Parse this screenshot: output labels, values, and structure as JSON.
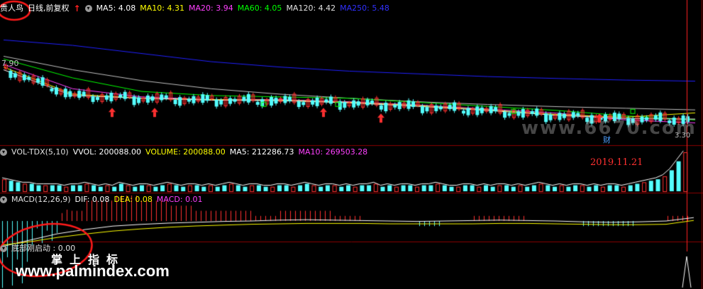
{
  "header": {
    "stock_name": "贵人鸟",
    "period": "日线,前复权",
    "ma5": "MA5: 4.08",
    "ma10": "MA10: 4.31",
    "ma20": "MA20: 3.94",
    "ma60": "MA60: 4.05",
    "ma120": "MA120: 4.42",
    "ma250": "MA250: 5.48"
  },
  "price_high_label": "7.90",
  "price_low_label": "3.30",
  "date_annotation": "2019.11.21",
  "cai_label": "财",
  "volume_header": {
    "name": "VOL-TDX(5,10)",
    "vvol": "VVOL: 200088.00",
    "volume": "VOLUME: 200088.00",
    "ma5": "MA5: 212286.73",
    "ma10": "MA10: 269503.28"
  },
  "macd_header": {
    "name": "MACD(12,26,9)",
    "dif": "DIF: 0.08",
    "dea": "DEA: 0.08",
    "macd": "MACD: 0.01"
  },
  "indicator_header": {
    "name": "底部刚启动 : 0.00"
  },
  "watermarks": {
    "site": "www.palmindex.com",
    "brand": "掌上指标",
    "overlay": "www.6670.com"
  },
  "colors": {
    "ma5": "#ffffff",
    "ma10": "#ffff00",
    "ma20": "#ff40ff",
    "ma60": "#00ff00",
    "ma120": "#c0c0c0",
    "ma250": "#2020ff",
    "up": "#ff3030",
    "down": "#54ffff",
    "grid": "#8b0000"
  },
  "chart_data": {
    "type": "line",
    "ylim": [
      3.3,
      7.9
    ],
    "series": [
      {
        "name": "MA250",
        "values": [
          7.0,
          6.8,
          6.5,
          6.2,
          6.0,
          5.85,
          5.75,
          5.65,
          5.58,
          5.52,
          5.48
        ]
      },
      {
        "name": "MA120",
        "values": [
          6.4,
          5.9,
          5.5,
          5.2,
          5.0,
          4.85,
          4.72,
          4.62,
          4.54,
          4.48,
          4.42
        ]
      },
      {
        "name": "MA60",
        "values": [
          6.3,
          5.6,
          5.1,
          4.95,
          4.9,
          4.85,
          4.7,
          4.55,
          4.4,
          4.2,
          4.05
        ]
      },
      {
        "name": "MA20",
        "values": [
          6.1,
          5.2,
          4.9,
          4.8,
          4.8,
          4.72,
          4.6,
          4.45,
          4.3,
          4.05,
          3.94
        ]
      },
      {
        "name": "MA10",
        "values": [
          6.0,
          5.0,
          4.85,
          4.8,
          4.78,
          4.7,
          4.58,
          4.42,
          4.25,
          4.15,
          4.31
        ]
      },
      {
        "name": "MA5",
        "values": [
          5.9,
          4.95,
          4.85,
          4.78,
          4.76,
          4.68,
          4.55,
          4.4,
          4.22,
          4.1,
          4.08
        ]
      }
    ],
    "volume": [
      8,
      7,
      6,
      5,
      5,
      4,
      4,
      4,
      4,
      3,
      4,
      4,
      5,
      4,
      3,
      4,
      3,
      5,
      4,
      3,
      4,
      4,
      3,
      4,
      5,
      4,
      3,
      4,
      4,
      3,
      4,
      3,
      4,
      5,
      4,
      3,
      4,
      4,
      3,
      3,
      4,
      4,
      3,
      4,
      5,
      4,
      3,
      4,
      4,
      3,
      4,
      3,
      4,
      4,
      5,
      3,
      4,
      3,
      4,
      4,
      3,
      4,
      4,
      5,
      4,
      3,
      3,
      4,
      4,
      3,
      4,
      3,
      4,
      4,
      3,
      4,
      3,
      4,
      5,
      4,
      3,
      4,
      3,
      4,
      4,
      3,
      4,
      3,
      4,
      4,
      3,
      4,
      5,
      6,
      7,
      8,
      10,
      14,
      20,
      26
    ],
    "macd_dif": [
      -0.6,
      -0.45,
      -0.3,
      -0.2,
      -0.12,
      -0.08,
      -0.05,
      -0.03,
      -0.01,
      0.0,
      0.02,
      0.03,
      0.02,
      0.01,
      0.0,
      -0.01,
      0.0,
      0.01,
      0.02,
      0.01,
      0.0,
      -0.02,
      -0.03,
      -0.02,
      0.0,
      0.08
    ],
    "macd_dea": [
      -0.5,
      -0.42,
      -0.32,
      -0.24,
      -0.17,
      -0.12,
      -0.08,
      -0.05,
      -0.03,
      -0.01,
      0.0,
      0.01,
      0.01,
      0.01,
      0.0,
      0.0,
      0.0,
      0.0,
      0.01,
      0.01,
      0.0,
      -0.01,
      -0.02,
      -0.02,
      -0.01,
      0.08
    ]
  }
}
